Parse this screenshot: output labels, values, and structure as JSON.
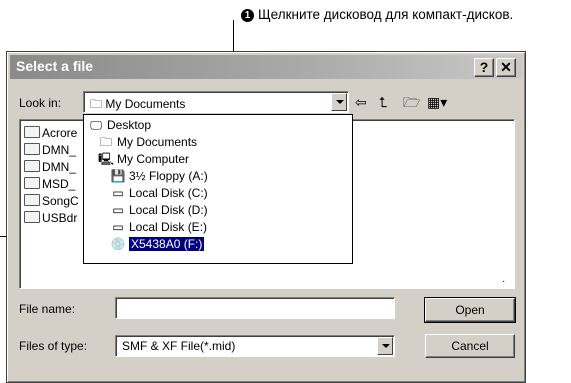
{
  "callout": {
    "number": "1",
    "text": "Щелкните дисковод для компакт-дисков."
  },
  "dialog": {
    "title": "Select a file",
    "help_button": "?",
    "close_button": "✕",
    "look_in_label": "Look in:",
    "look_in_value": "My Documents",
    "toolbar_icons": [
      "back-icon",
      "up-folder-icon",
      "new-folder-icon",
      "views-menu-icon"
    ],
    "files": [
      "Acrore",
      "DMN_",
      "DMN_",
      "MSD_",
      "SongC",
      "USBdr"
    ],
    "location_dropdown": [
      {
        "label": "Desktop",
        "icon": "desktop-icon"
      },
      {
        "label": "My Documents",
        "icon": "documents-icon"
      },
      {
        "label": "My Computer",
        "icon": "computer-icon"
      },
      {
        "label": "3½ Floppy (A:)",
        "icon": "floppy-icon"
      },
      {
        "label": "Local Disk (C:)",
        "icon": "disk-icon"
      },
      {
        "label": "Local Disk (D:)",
        "icon": "disk-icon"
      },
      {
        "label": "Local Disk (E:)",
        "icon": "disk-icon"
      },
      {
        "label": "X5438A0 (F:)",
        "icon": "cd-drive-icon",
        "selected": true
      }
    ],
    "file_name_label": "File name:",
    "file_name_value": "",
    "files_of_type_label": "Files of type:",
    "files_of_type_value": "SMF & XF File(*.mid)",
    "open_button": "Open",
    "cancel_button": "Cancel"
  }
}
